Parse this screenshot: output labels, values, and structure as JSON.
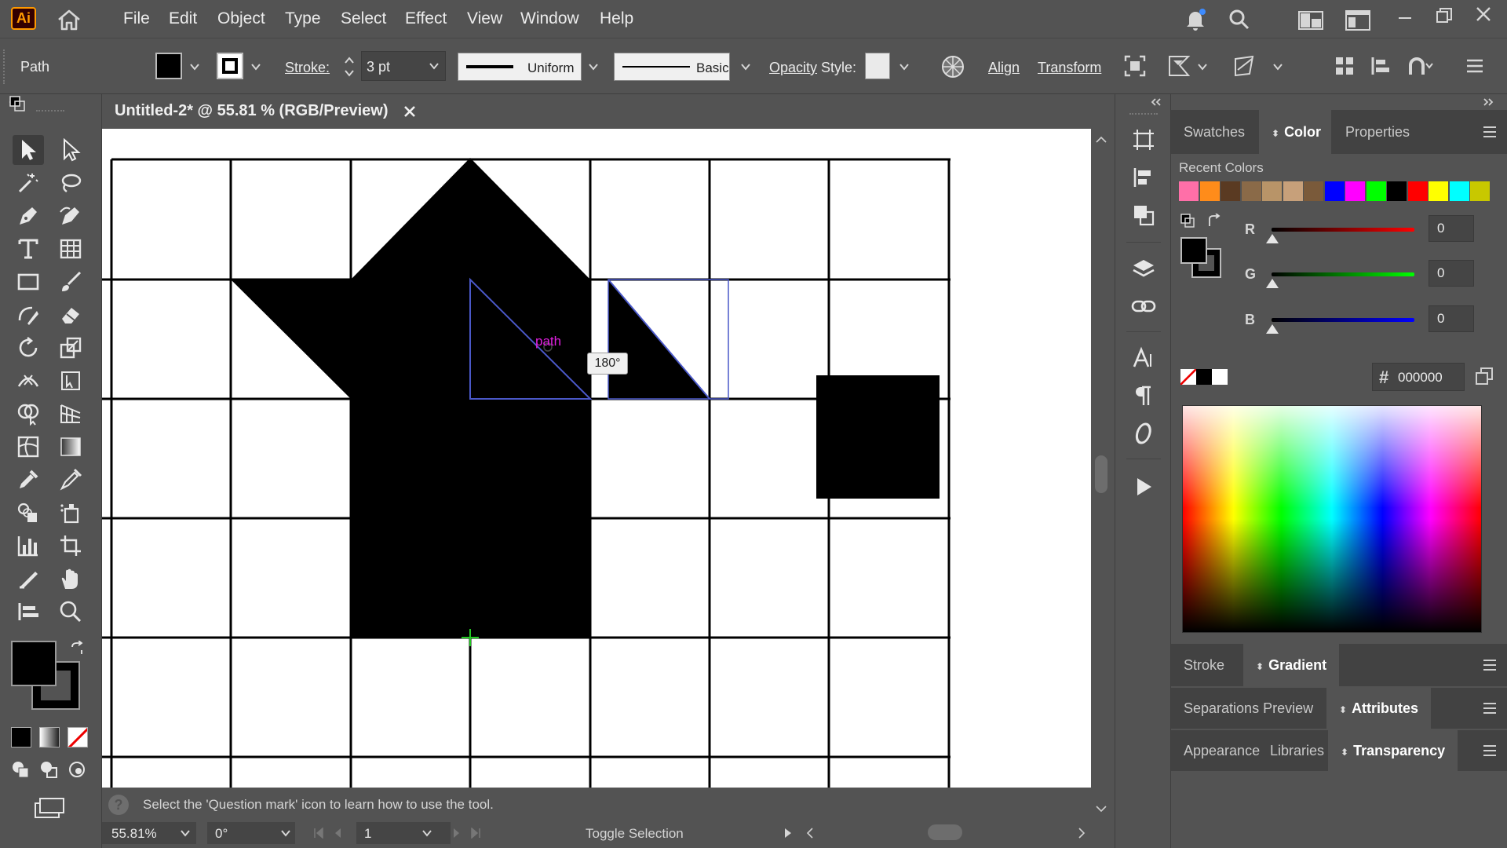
{
  "app": {
    "logo_text": "Ai",
    "menu": [
      "File",
      "Edit",
      "Object",
      "Type",
      "Select",
      "Effect",
      "View",
      "Window",
      "Help"
    ]
  },
  "control_bar": {
    "selection_type": "Path",
    "stroke_label": "Stroke:",
    "stroke_weight": "3 pt",
    "variable_width_profile": "Uniform",
    "brush_definition": "Basic",
    "opacity_label": "Opacity",
    "style_label": "Style:",
    "align_label": "Align",
    "transform_label": "Transform"
  },
  "document": {
    "tab_title": "Untitled-2* @ 55.81 % (RGB/Preview)"
  },
  "canvas": {
    "smart_guide_label": "path",
    "rotation_tooltip": "180°"
  },
  "status": {
    "hint": "Select the 'Question mark' icon to learn how to use the tool.",
    "zoom": "55.81%",
    "rotation": "0°",
    "artboard_number": "1",
    "mode": "Toggle Selection"
  },
  "panels": {
    "top_tabs": [
      "Swatches",
      "Color",
      "Properties"
    ],
    "active_top_tab": "Color",
    "recent_colors_label": "Recent Colors",
    "recent_colors": [
      "#ff6fa8",
      "#ff8c1a",
      "#5a3a22",
      "#8a6a48",
      "#b89468",
      "#c7a07a",
      "#7a5a3a",
      "#0000ff",
      "#ff00ff",
      "#00ff00",
      "#000000",
      "#ff0000",
      "#ffff00",
      "#00ffff",
      "#c8c800"
    ],
    "channels": [
      {
        "label": "R",
        "value": "0"
      },
      {
        "label": "G",
        "value": "0"
      },
      {
        "label": "B",
        "value": "0"
      }
    ],
    "hex_symbol": "#",
    "hex_value": "000000",
    "stroke_tab": "Stroke",
    "gradient_tab": "Gradient",
    "separations_tab": "Separations Preview",
    "attributes_tab": "Attributes",
    "appearance_tab": "Appearance",
    "libraries_tab": "Libraries",
    "transparency_tab": "Transparency"
  },
  "colors": {
    "ui_bg": "#535353",
    "panel_dark": "#424242",
    "selection_blue": "#4a58c8",
    "smart_guide_magenta": "#e020e0",
    "guide_green": "#22c822"
  }
}
